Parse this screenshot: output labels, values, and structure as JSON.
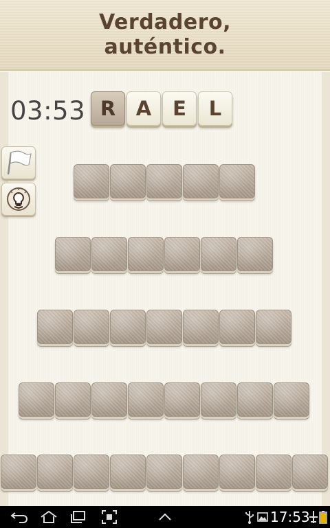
{
  "clue": {
    "line1": "Verdadero,",
    "line2": "auténtico."
  },
  "timer": "03:53",
  "letters": [
    {
      "char": "R",
      "used": true
    },
    {
      "char": "A",
      "used": false
    },
    {
      "char": "E",
      "used": false
    },
    {
      "char": "L",
      "used": false
    }
  ],
  "rows": [
    {
      "count": 5
    },
    {
      "count": 6
    },
    {
      "count": 7
    },
    {
      "count": 8
    },
    {
      "count": 9
    }
  ],
  "side_buttons": {
    "flag_icon": "white-flag-icon",
    "hint_icon": "lightbulb-icon"
  },
  "status_bar": {
    "time": "17:53"
  },
  "colors": {
    "clue_text": "#5a4431",
    "slot": "#b3a797"
  }
}
